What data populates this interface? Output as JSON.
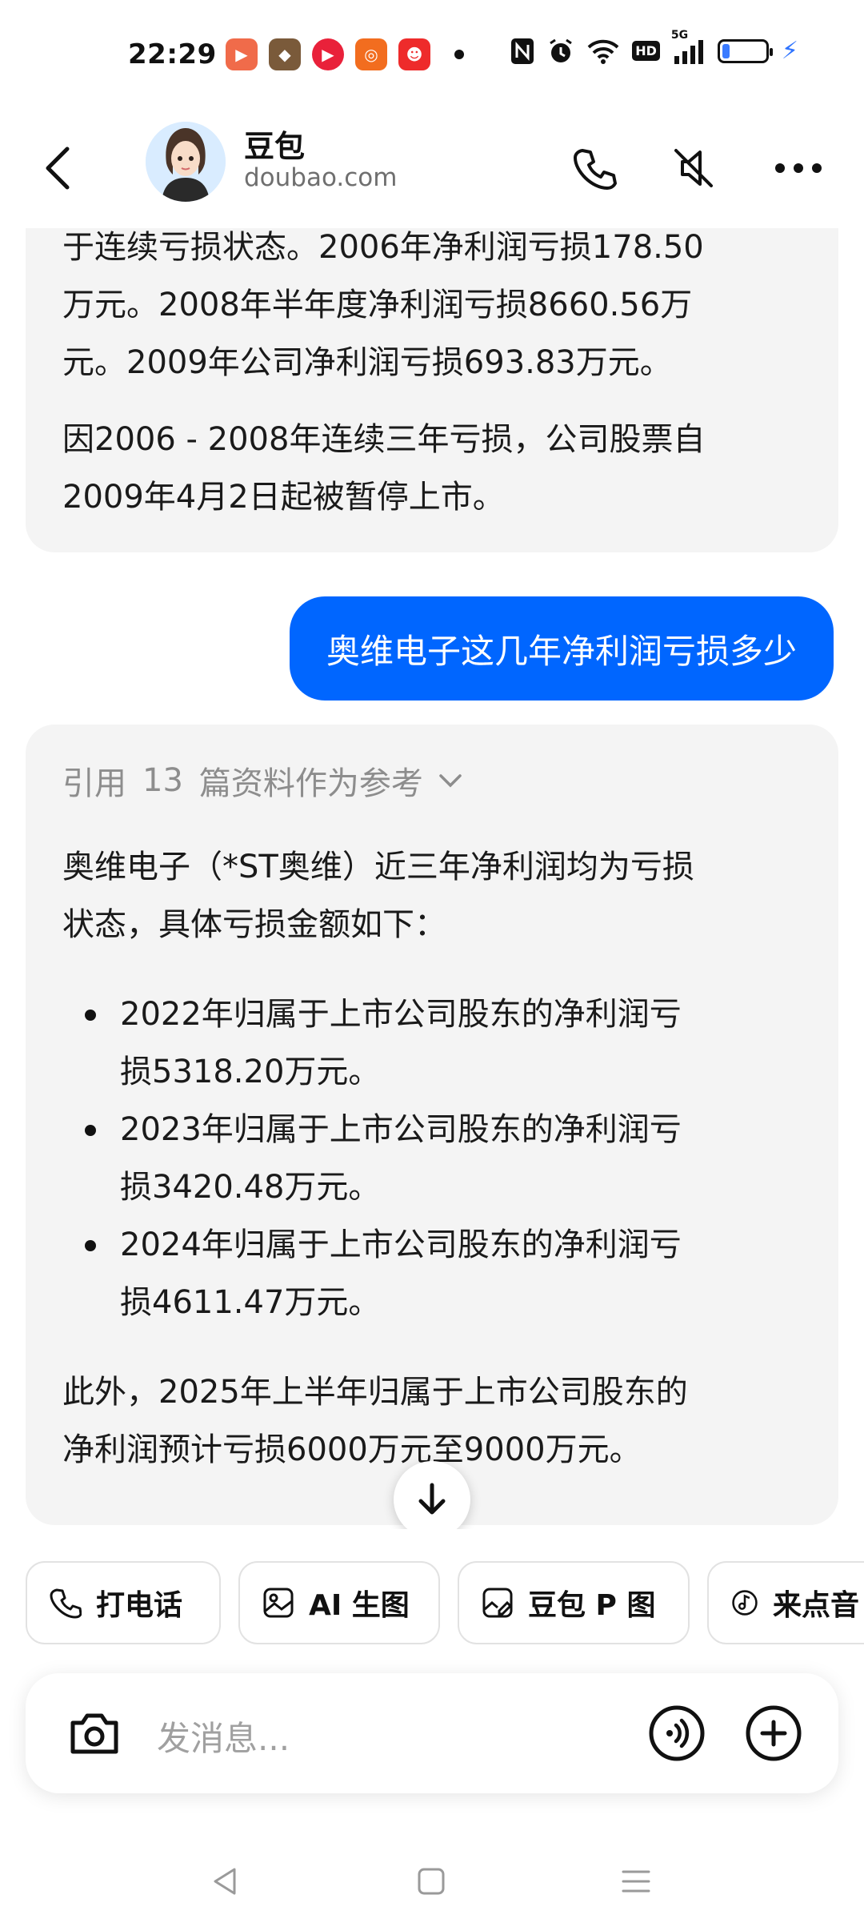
{
  "status_bar": {
    "time": "22:29",
    "notification_icons": [
      "game-icon",
      "photo-icon",
      "video-icon",
      "shop-icon",
      "news-icon"
    ],
    "system_icons": [
      "nfc-icon",
      "alarm-icon",
      "wifi-icon",
      "hd-icon",
      "5g-signal-icon",
      "battery-icon",
      "charging-icon"
    ],
    "network_label": "5G",
    "hd_label": "HD",
    "battery_level": 0.18,
    "colors": {
      "battery": "#3b7bff",
      "charging": "#2f74ff"
    }
  },
  "header": {
    "title": "豆包",
    "subtitle": "doubao.com"
  },
  "chat": {
    "prev_message": {
      "lines": [
        "于连续亏损状态。2006年净利润亏损178.50",
        "万元。2008年半年度净利润亏损8660.56万",
        "元。2009年公司净利润亏损693.83万元。"
      ],
      "paragraph2": [
        "因2006 - 2008年连续三年亏损，公司股票自",
        "2009年4月2日起被暂停上市。"
      ]
    },
    "user_message": "奥维电子这几年净利润亏损多少",
    "reply": {
      "reference_prefix": "引用",
      "reference_count": "13",
      "reference_suffix": "篇资料作为参考",
      "intro": [
        "奥维电子（*ST奥维）近三年净利润均为亏损",
        "状态，具体亏损金额如下："
      ],
      "bullets": [
        [
          "2022年归属于上市公司股东的净利润亏",
          "损5318.20万元。"
        ],
        [
          "2023年归属于上市公司股东的净利润亏",
          "损3420.48万元。"
        ],
        [
          "2024年归属于上市公司股东的净利润亏",
          "损4611.47万元。"
        ]
      ],
      "outro": [
        "此外，2025年上半年归属于上市公司股东的",
        "净利润预计亏损6000万元至9000万元。"
      ]
    }
  },
  "quick_actions": [
    {
      "label": "打电话",
      "icon": "phone-icon"
    },
    {
      "label": "AI 生图",
      "icon": "image-icon"
    },
    {
      "label": "豆包 P 图",
      "icon": "edit-image-icon"
    },
    {
      "label": "来点音",
      "icon": "music-icon"
    }
  ],
  "input": {
    "placeholder": "发消息..."
  },
  "colors": {
    "user_bubble": "#0066ff",
    "ai_bubble": "#f4f4f4"
  }
}
